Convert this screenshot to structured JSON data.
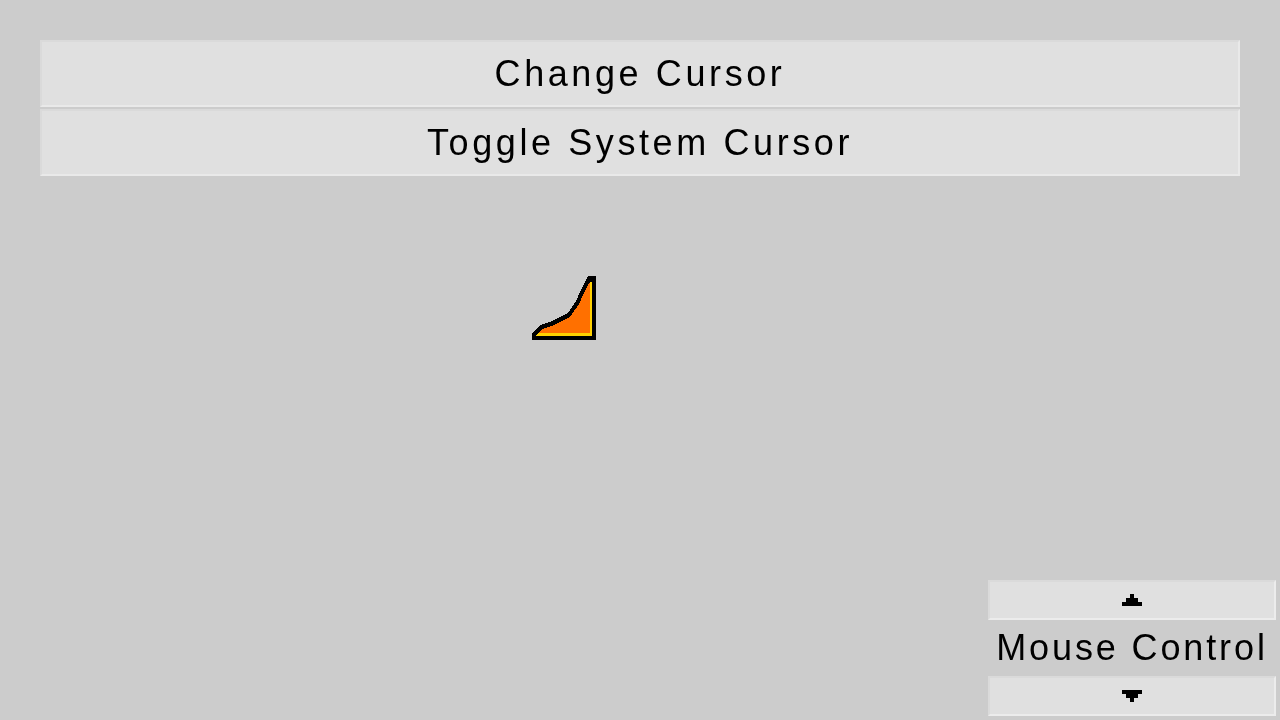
{
  "buttons": [
    {
      "label": "Change Cursor"
    },
    {
      "label": "Toggle System Cursor"
    }
  ],
  "mouse_control": {
    "label": "Mouse Control"
  }
}
